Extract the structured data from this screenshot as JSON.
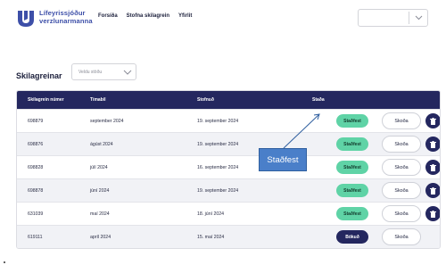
{
  "header": {
    "logo_line1": "Lífeyrissjóður",
    "logo_line2": "verzlunarmanna",
    "nav": [
      "Forsíða",
      "Stofna skilagrein",
      "Yfirlit"
    ],
    "brand_color": "#3d4fa8"
  },
  "page": {
    "title": "Skilagreinar",
    "filter_placeholder": "Veldu stöðu"
  },
  "table": {
    "columns": [
      "Skilagrein númer",
      "Tímabil",
      "Stofnuð",
      "Staða"
    ],
    "header_color": "#24275f",
    "view_label": "Skoða",
    "rows": [
      {
        "id": "698879",
        "period": "september 2024",
        "created": "19. september 2024",
        "status": "Staðfest",
        "status_kind": "confirmed",
        "deletable": true
      },
      {
        "id": "698876",
        "period": "ágúst 2024",
        "created": "19. september 2024",
        "status": "Staðfest",
        "status_kind": "confirmed",
        "deletable": true
      },
      {
        "id": "698828",
        "period": "júlí 2024",
        "created": "16. september 2024",
        "status": "Staðfest",
        "status_kind": "confirmed",
        "deletable": true
      },
      {
        "id": "698878",
        "period": "júní 2024",
        "created": "19. september 2024",
        "status": "Staðfest",
        "status_kind": "confirmed",
        "deletable": true
      },
      {
        "id": "631039",
        "period": "maí 2024",
        "created": "18. júní 2024",
        "status": "Staðfest",
        "status_kind": "confirmed",
        "deletable": true
      },
      {
        "id": "619111",
        "period": "apríl 2024",
        "created": "15. maí 2024",
        "status": "Bókuð",
        "status_kind": "received",
        "deletable": false
      }
    ]
  },
  "callout": {
    "text": "Staðfest",
    "color": "#4a7fc9"
  }
}
